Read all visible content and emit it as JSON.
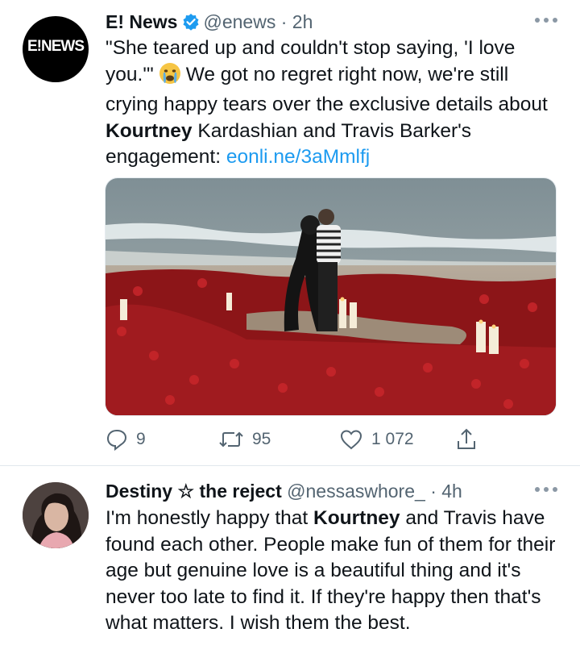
{
  "tweets": [
    {
      "author_name": "E! News",
      "avatar_text": "E!NEWS",
      "handle": "@enews",
      "separator": " · ",
      "time": "2h",
      "text_parts": {
        "p1": "\"She teared up and couldn't stop saying, 'I love you.'\"",
        "p2": "We got no regret right now, we're still crying happy tears over the exclusive details about",
        "highlight": "Kourtney",
        "p3": "Kardashian and Travis Barker's engagement:",
        "link": "eonli.ne/3aMmlfj"
      },
      "stats": {
        "replies": "9",
        "retweets": "95",
        "likes": "1 072"
      }
    },
    {
      "author_name": "Destiny ☆ the reject",
      "handle": "@nessaswhore_",
      "separator": " · ",
      "time": "4h",
      "text_parts": {
        "p1": "I'm honestly happy that",
        "highlight": "Kourtney",
        "p2": "and Travis have found each other. People make fun of them for their age but genuine love is a beautiful thing and it's never too late to find it. If they're happy then that's what matters. I wish them the best."
      }
    }
  ],
  "colors": {
    "link": "#1d9bf0",
    "verified": "#1d9bf0",
    "muted": "#536471"
  },
  "icons": [
    "verified-badge-icon",
    "crying-face-emoji",
    "reply-icon",
    "retweet-icon",
    "like-icon",
    "share-icon",
    "more-icon"
  ]
}
